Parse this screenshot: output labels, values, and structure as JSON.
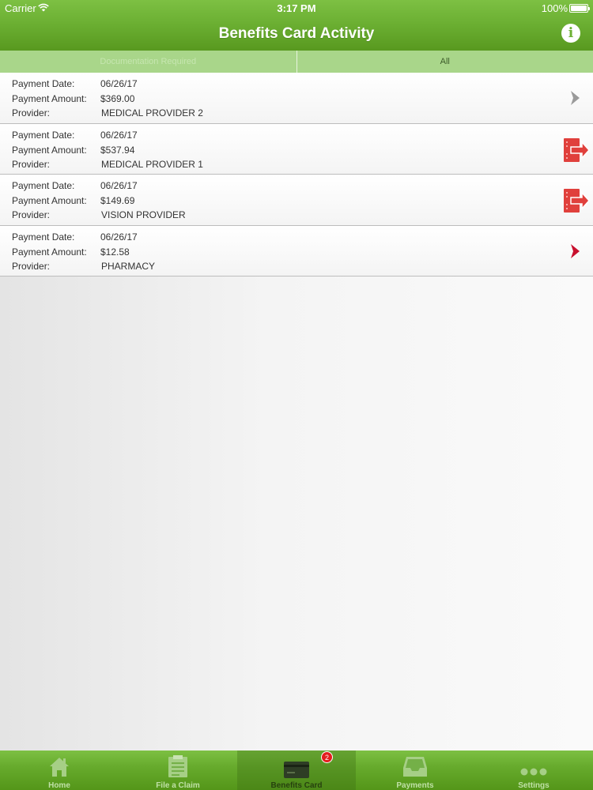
{
  "status_bar": {
    "carrier": "Carrier",
    "time": "3:17 PM",
    "battery": "100%"
  },
  "nav": {
    "title": "Benefits Card Activity",
    "info_icon": "info-icon"
  },
  "segments": {
    "documentation_required": "Documentation Required",
    "all": "All",
    "selected": "All"
  },
  "labels": {
    "payment_date": "Payment Date:",
    "payment_amount": "Payment Amount:",
    "provider": "Provider:"
  },
  "transactions": [
    {
      "payment_date": "06/26/17",
      "payment_amount": "$369.00",
      "provider": "MEDICAL PROVIDER 2",
      "icon": "chevron-right-gray-icon"
    },
    {
      "payment_date": "06/26/17",
      "payment_amount": "$537.94",
      "provider": "MEDICAL PROVIDER 1",
      "icon": "document-required-icon"
    },
    {
      "payment_date": "06/26/17",
      "payment_amount": "$149.69",
      "provider": "VISION PROVIDER",
      "icon": "document-required-icon"
    },
    {
      "payment_date": "06/26/17",
      "payment_amount": "$12.58",
      "provider": "PHARMACY",
      "icon": "chevron-right-red-icon"
    }
  ],
  "tabbar": {
    "tabs": [
      {
        "label": "Home",
        "icon": "home-icon"
      },
      {
        "label": "File a Claim",
        "icon": "claim-form-icon"
      },
      {
        "label": "Benefits Card",
        "icon": "card-icon",
        "badge": "2",
        "active": true
      },
      {
        "label": "Payments",
        "icon": "inbox-icon"
      },
      {
        "label": "Settings",
        "icon": "more-dots-icon"
      }
    ]
  },
  "colors": {
    "brand_green": "#6cb033",
    "segment_bg": "#a9d68a",
    "alert_red": "#e0403c",
    "chevron_red": "#c8102e",
    "badge_red": "#e41e1e"
  }
}
